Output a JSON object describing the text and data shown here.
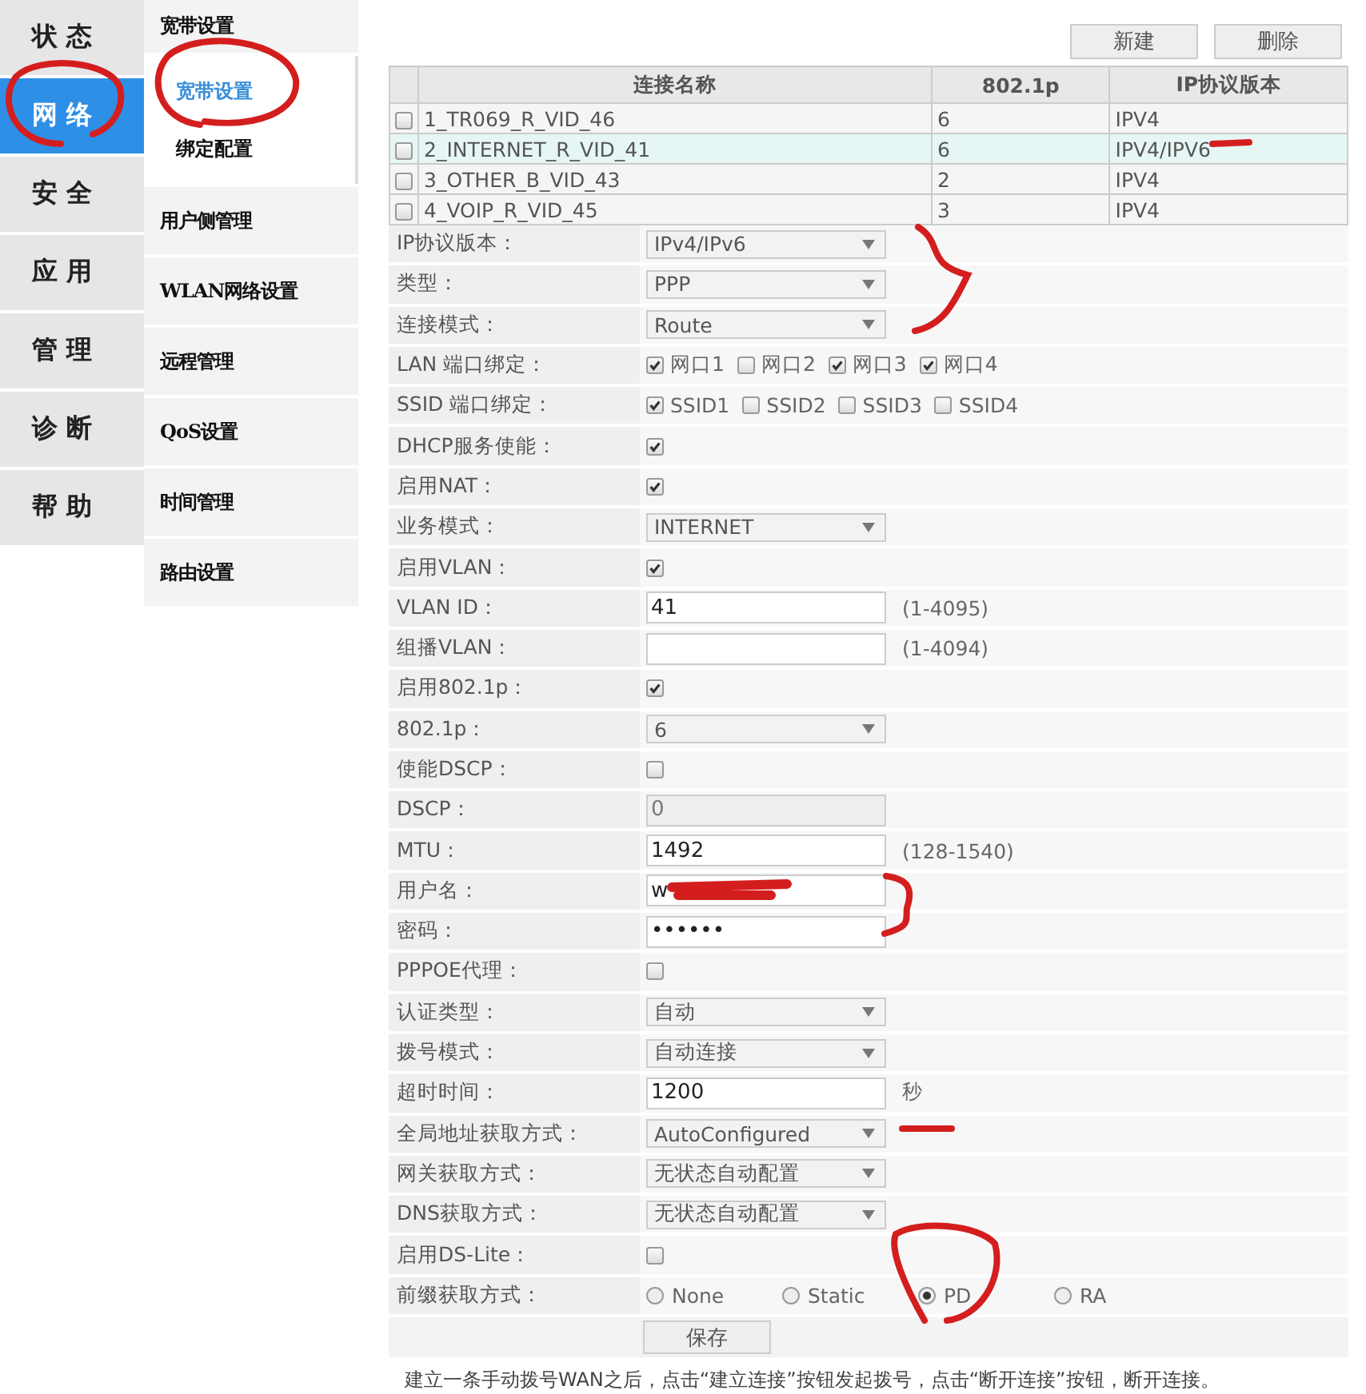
{
  "nav": [
    {
      "label": "状 态",
      "selected": false
    },
    {
      "label": "网 络",
      "selected": true
    },
    {
      "label": "安 全",
      "selected": false
    },
    {
      "label": "应 用",
      "selected": false
    },
    {
      "label": "管 理",
      "selected": false
    },
    {
      "label": "诊 断",
      "selected": false
    },
    {
      "label": "帮 助",
      "selected": false
    }
  ],
  "subnav": [
    {
      "label": "宽带设置",
      "children": [
        {
          "label": "宽带设置",
          "selected": true
        },
        {
          "label": "绑定配置",
          "selected": false
        }
      ]
    },
    {
      "label": "用户侧管理"
    },
    {
      "label": "WLAN网络设置"
    },
    {
      "label": "远程管理"
    },
    {
      "label": "QoS设置"
    },
    {
      "label": "时间管理"
    },
    {
      "label": "路由设置"
    }
  ],
  "toolbar": [
    "新建",
    "删除"
  ],
  "table": {
    "columns": [
      "连接名称",
      "802.1p",
      "IP协议版本"
    ],
    "rows": [
      {
        "checked": false,
        "selected": false,
        "cells": [
          "1_TR069_R_VID_46",
          "6",
          "IPV4"
        ]
      },
      {
        "checked": false,
        "selected": true,
        "cells": [
          "2_INTERNET_R_VID_41",
          "6",
          "IPV4/IPV6"
        ]
      },
      {
        "checked": false,
        "selected": false,
        "cells": [
          "3_OTHER_B_VID_43",
          "2",
          "IPV4"
        ]
      },
      {
        "checked": false,
        "selected": false,
        "cells": [
          "4_VOIP_R_VID_45",
          "3",
          "IPV4"
        ]
      }
    ]
  },
  "form": [
    {
      "label": "IP协议版本：",
      "kind": "select",
      "value": "IPv4/IPv6"
    },
    {
      "label": "类型：",
      "kind": "select",
      "value": "PPP"
    },
    {
      "label": "连接模式：",
      "kind": "select",
      "value": "Route"
    },
    {
      "label": "LAN 端口绑定：",
      "kind": "checks",
      "options": [
        {
          "label": "网口1",
          "checked": true
        },
        {
          "label": "网口2",
          "checked": false
        },
        {
          "label": "网口3",
          "checked": true
        },
        {
          "label": "网口4",
          "checked": true
        }
      ]
    },
    {
      "label": "SSID 端口绑定：",
      "kind": "checks",
      "options": [
        {
          "label": "SSID1",
          "checked": true
        },
        {
          "label": "SSID2",
          "checked": false
        },
        {
          "label": "SSID3",
          "checked": false
        },
        {
          "label": "SSID4",
          "checked": false
        }
      ]
    },
    {
      "label": "DHCP服务使能：",
      "kind": "checkbox",
      "checked": true
    },
    {
      "label": "启用NAT：",
      "kind": "checkbox",
      "checked": true
    },
    {
      "label": "业务模式：",
      "kind": "select",
      "value": "INTERNET"
    },
    {
      "label": "启用VLAN：",
      "kind": "checkbox",
      "checked": true
    },
    {
      "label": "VLAN ID：",
      "kind": "text",
      "value": "41",
      "hint": "(1-4095)"
    },
    {
      "label": "组播VLAN：",
      "kind": "text",
      "hint": "(1-4094)"
    },
    {
      "label": "启用802.1p：",
      "kind": "checkbox",
      "checked": true
    },
    {
      "label": "802.1p：",
      "kind": "select",
      "value": "6"
    },
    {
      "label": "使能DSCP：",
      "kind": "checkbox",
      "checked": false
    },
    {
      "label": "DSCP：",
      "kind": "text",
      "value": "0",
      "disabled": true
    },
    {
      "label": "MTU：",
      "kind": "text",
      "value": "1492",
      "hint": "(128-1540)"
    },
    {
      "label": "用户名：",
      "kind": "text",
      "value": "w",
      "scribbled": true
    },
    {
      "label": "密码：",
      "kind": "password",
      "value": "••••••"
    },
    {
      "label": "PPPOE代理：",
      "kind": "checkbox",
      "checked": false
    },
    {
      "label": "认证类型：",
      "kind": "select",
      "value": "自动"
    },
    {
      "label": "拨号模式：",
      "kind": "select",
      "value": "自动连接"
    },
    {
      "label": "超时时间：",
      "kind": "text",
      "value": "1200",
      "hint": "秒"
    },
    {
      "label": "全局地址获取方式：",
      "kind": "select",
      "value": "AutoConfigured"
    },
    {
      "label": "网关获取方式：",
      "kind": "select",
      "value": "无状态自动配置"
    },
    {
      "label": "DNS获取方式：",
      "kind": "select",
      "value": "无状态自动配置"
    },
    {
      "label": "启用DS-Lite：",
      "kind": "checkbox",
      "checked": false
    },
    {
      "label": "前缀获取方式：",
      "kind": "radios",
      "options": [
        {
          "label": "None",
          "selected": false
        },
        {
          "label": "Static",
          "selected": false
        },
        {
          "label": "PD",
          "selected": true
        },
        {
          "label": "RA",
          "selected": false
        }
      ]
    }
  ],
  "save": "保存",
  "note": "建立一条手动拨号WAN之后，点击“建立连接”按钮发起拨号，点击“断开连接”按钮，断开连接。"
}
